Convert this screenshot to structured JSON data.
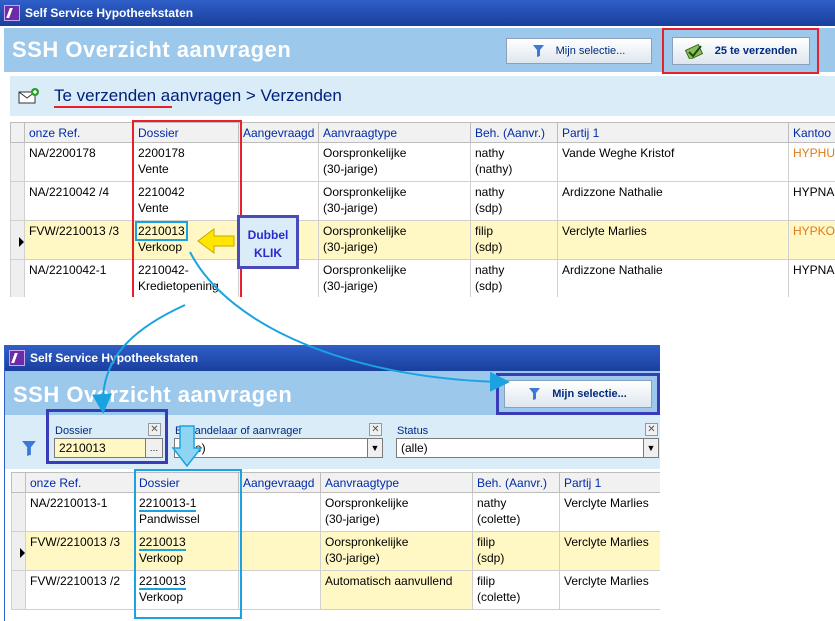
{
  "window1": {
    "title": "Self Service Hypotheekstaten",
    "header_title": "SSH  Overzicht aanvragen",
    "filter_button": "Mijn selectie...",
    "send_button": "25 te verzenden",
    "breadcrumb": {
      "part1": "Te verzenden",
      "part2": " aanvragen > Verzenden"
    },
    "columns": [
      "onze Ref.",
      "Dossier",
      "Aangevraagd",
      "Aanvraagtype",
      "Beh. (Aanvr.)",
      "Partij 1",
      "Kantoo"
    ],
    "rows": [
      {
        "ref": "NA/2200178",
        "dossier1": "2200178",
        "dossier2": "Vente",
        "aangevraagd": "",
        "type1": "Oorspronkelijke",
        "type2": "(30-jarige)",
        "beh1": "nathy",
        "beh2": "(nathy)",
        "partij": "Vande Weghe Kristof",
        "kantoor": "HYPHU"
      },
      {
        "ref": "NA/2210042 /4",
        "dossier1": "2210042",
        "dossier2": "Vente",
        "aangevraagd": "",
        "type1": "Oorspronkelijke",
        "type2": "(30-jarige)",
        "beh1": "nathy",
        "beh2": "(sdp)",
        "partij": "Ardizzone Nathalie",
        "kantoor": "HYPNA"
      },
      {
        "ref": "FVW/2210013 /3",
        "dossier1": "2210013",
        "dossier2": "Verkoop",
        "aangevraagd": "",
        "type1": "Oorspronkelijke",
        "type2": "(30-jarige)",
        "beh1": "filip",
        "beh2": "(sdp)",
        "partij": "Verclyte Marlies",
        "kantoor": "HYPKO"
      },
      {
        "ref": "NA/2210042-1",
        "dossier1": "2210042-",
        "dossier2": "Kredietopening",
        "aangevraagd": "",
        "type1": "Oorspronkelijke",
        "type2": "(30-jarige)",
        "beh1": "nathy",
        "beh2": "(sdp)",
        "partij": "Ardizzone Nathalie",
        "kantoor": "HYPNA"
      }
    ],
    "annotation": {
      "line1": "Dubbel",
      "line2": "KLIK"
    }
  },
  "window2": {
    "title": "Self Service Hypotheekstaten",
    "header_title": "SSH  Overzicht aanvragen",
    "filter_button": "Mijn selectie...",
    "filters": [
      {
        "label": "Dossier",
        "value": "2210013"
      },
      {
        "label": "Behandelaar of aanvrager",
        "value": "(alle)"
      },
      {
        "label": "Status",
        "value": "(alle)"
      }
    ],
    "columns": [
      "onze Ref.",
      "Dossier",
      "Aangevraagd",
      "Aanvraagtype",
      "Beh. (Aanvr.)",
      "Partij 1"
    ],
    "rows": [
      {
        "ref": "NA/2210013-1",
        "dossier1": "2210013-1",
        "dossier2": "Pandwissel",
        "aangevraagd": "",
        "type1": "Oorspronkelijke",
        "type2": "(30-jarige)",
        "beh1": "nathy",
        "beh2": "(colette)",
        "partij": "Verclyte Marlies"
      },
      {
        "ref": "FVW/2210013 /3",
        "dossier1": "2210013",
        "dossier2": "Verkoop",
        "aangevraagd": "",
        "type1": "Oorspronkelijke",
        "type2": "(30-jarige)",
        "beh1": "filip",
        "beh2": "(sdp)",
        "partij": "Verclyte Marlies"
      },
      {
        "ref": "FVW/2210013 /2",
        "dossier1": "2210013",
        "dossier2": "Verkoop",
        "aangevraagd": "",
        "type1": "Automatisch aanvullend",
        "type2": "",
        "beh1": "filip",
        "beh2": "(colette)",
        "partij": "Verclyte Marlies"
      }
    ]
  },
  "colors": {
    "title_bar": "#1a3f9c",
    "header_bg": "#9cc8ec",
    "selected_row": "#fff7c4",
    "red_highlight": "#e8202c",
    "blue_highlight": "#3a3bb6",
    "arrow_cyan": "#1aa3e0",
    "arrow_yellow": "#ffe600"
  }
}
